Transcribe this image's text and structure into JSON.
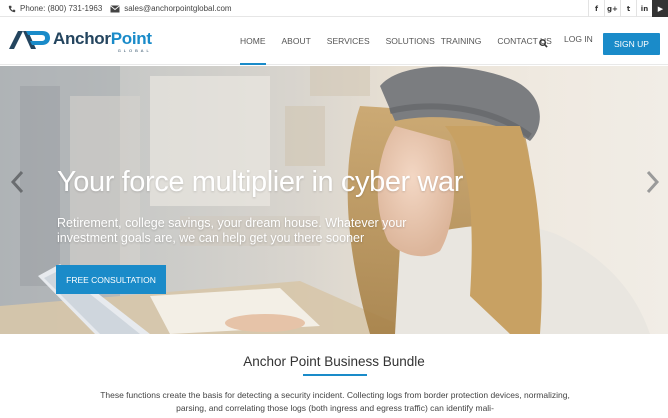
{
  "topbar": {
    "phone": "Phone: (800) 731-1963",
    "email": "sales@anchorpointglobal.com",
    "social": [
      {
        "label": "f",
        "icon": "facebook-icon"
      },
      {
        "label": "g+",
        "icon": "google-plus-icon"
      },
      {
        "label": "t",
        "icon": "twitter-icon"
      },
      {
        "label": "in",
        "icon": "linkedin-icon"
      },
      {
        "label": "▶",
        "icon": "youtube-icon"
      }
    ]
  },
  "brand": {
    "name_part1": "Anchor",
    "name_part2": "Point",
    "tagline": "GLOBAL",
    "accent": "#1a8bc9",
    "dark": "#24455f"
  },
  "nav": {
    "items": [
      "HOME",
      "ABOUT",
      "SERVICES",
      "SOLUTIONS",
      "TRAINING",
      "CONTACT US"
    ],
    "active": "HOME",
    "login": "LOG IN",
    "signup": "SIGN UP"
  },
  "hero": {
    "title": "Your force multiplier in cyber war",
    "subtitle": "Retirement, college savings, your dream house. Whatever your investment goals are, we can help get you there sooner",
    "cta": "FREE CONSULTATION"
  },
  "section": {
    "title": "Anchor Point Business Bundle",
    "body": "These functions create the basis for detecting a security incident. Collecting logs from border protection devices, normalizing, parsing, and correlating those logs (both ingress and egress traffic) can identify mali-"
  }
}
